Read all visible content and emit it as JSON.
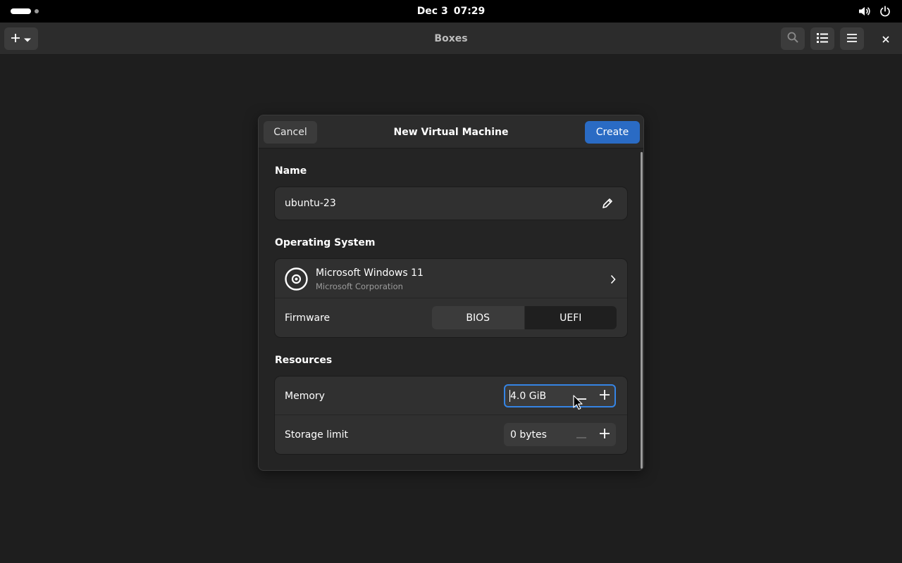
{
  "system": {
    "date": "Dec 3",
    "time": "07:29",
    "icons": [
      "activities-indicator",
      "volume-icon",
      "power-icon"
    ]
  },
  "window": {
    "title": "Boxes",
    "icons": [
      "plus-icon",
      "chevron-down-icon",
      "search-icon",
      "list-view-icon",
      "hamburger-menu-icon",
      "close-icon"
    ]
  },
  "dialog": {
    "title": "New Virtual Machine",
    "cancel_label": "Cancel",
    "create_label": "Create",
    "accent": "#2a6bc4",
    "name_section": {
      "title": "Name",
      "value": "ubuntu-23",
      "icon": "pencil-edit-icon"
    },
    "os_section": {
      "title": "Operating System",
      "os_name": "Microsoft Windows 11",
      "os_vendor": "Microsoft Corporation",
      "icon": "disc-icon",
      "firmware_label": "Firmware",
      "firmware_options": [
        "BIOS",
        "UEFI"
      ],
      "firmware_selected": "UEFI"
    },
    "resources_section": {
      "title": "Resources",
      "memory_label": "Memory",
      "memory_value": "4.0 GiB",
      "storage_label": "Storage limit",
      "storage_value": "0 bytes"
    }
  }
}
